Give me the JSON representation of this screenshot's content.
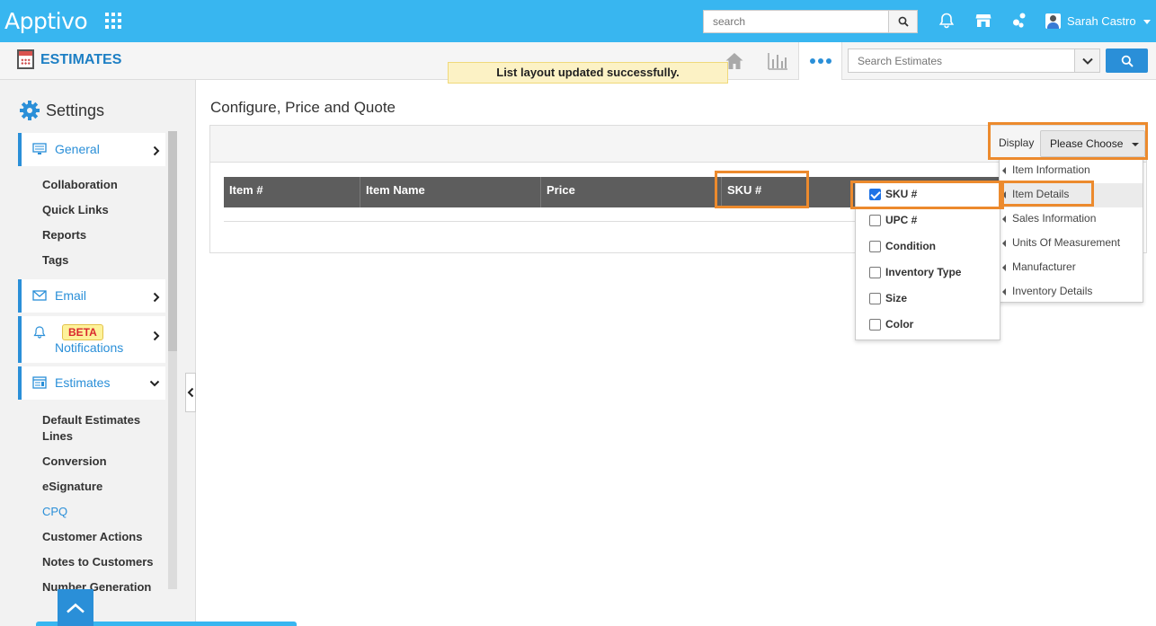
{
  "app": {
    "logo": "Apptivo",
    "title": "ESTIMATES"
  },
  "header": {
    "search_placeholder": "search",
    "user_name": "Sarah Castro"
  },
  "subheader": {
    "toast": "List layout updated successfully.",
    "search_placeholder": "Search Estimates"
  },
  "sidebar": {
    "title": "Settings",
    "general_label": "General",
    "general_items": [
      "Collaboration",
      "Quick Links",
      "Reports",
      "Tags"
    ],
    "email_label": "Email",
    "beta_badge": "BETA",
    "notifications_label": "Notifications",
    "estimates_label": "Estimates",
    "estimates_items": [
      "Default Estimates Lines",
      "Conversion",
      "eSignature",
      "CPQ",
      "Customer Actions",
      "Notes to Customers",
      "Number Generation"
    ],
    "active_item": "CPQ"
  },
  "main": {
    "title": "Configure, Price and Quote",
    "display_label": "Display",
    "display_value": "Please Choose",
    "columns": [
      "Item #",
      "Item Name",
      "Price",
      "SKU #"
    ]
  },
  "category_menu": {
    "items": [
      "Item Information",
      "Item Details",
      "Sales Information",
      "Units Of Measurement",
      "Manufacturer",
      "Inventory Details"
    ],
    "highlighted": "Item Details"
  },
  "field_menu": {
    "items": [
      {
        "label": "SKU #",
        "checked": true
      },
      {
        "label": "UPC #",
        "checked": false
      },
      {
        "label": "Condition",
        "checked": false
      },
      {
        "label": "Inventory Type",
        "checked": false
      },
      {
        "label": "Size",
        "checked": false
      },
      {
        "label": "Color",
        "checked": false
      }
    ]
  },
  "colors": {
    "topbar": "#38b6f0",
    "accent": "#2a8fd8",
    "highlight": "#ec8a2d",
    "grid_header": "#5d5d5d"
  }
}
